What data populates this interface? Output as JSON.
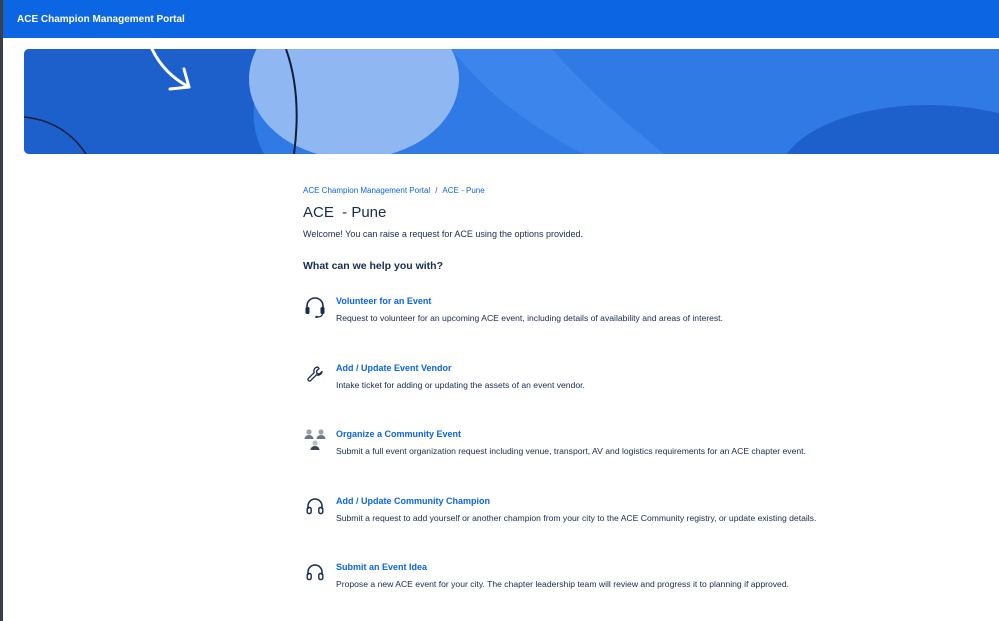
{
  "header": {
    "title": "ACE Champion Management Portal",
    "background_color": "#0c66e4"
  },
  "banner": {
    "colors": {
      "base": "#2f7ae5",
      "dark": "#1d5fcb",
      "light": "#8fb8f2",
      "line": "#0d1f3c"
    }
  },
  "breadcrumb": {
    "items": [
      {
        "label": "ACE Champion Management Portal"
      },
      {
        "label": "ACE - Pune"
      }
    ],
    "separator": "/"
  },
  "page": {
    "title": "ACE  - Pune",
    "welcome": "Welcome! You can raise a request for ACE using the options provided.",
    "section_heading": "What can we help you with?"
  },
  "requests": [
    {
      "icon": "headset-icon",
      "title": "Volunteer for an Event",
      "description": "Request to volunteer for an upcoming ACE event, including details of availability and areas of interest."
    },
    {
      "icon": "wrench-icon",
      "title": "Add / Update Event Vendor",
      "description": "Intake ticket for adding or updating the assets of an event vendor."
    },
    {
      "icon": "people-group-icon",
      "title": "Organize a Community Event",
      "description": "Submit a full event organization request including venue, transport, AV and logistics requirements for an ACE chapter event."
    },
    {
      "icon": "headphones-icon",
      "title": "Add / Update Community Champion",
      "description": "Submit a request to add yourself or another champion from your city to the ACE Community registry, or update existing details."
    },
    {
      "icon": "headphones-icon",
      "title": "Submit an Event Idea",
      "description": "Propose a new ACE event for your city. The chapter leadership team will review and progress it to planning if approved."
    }
  ]
}
